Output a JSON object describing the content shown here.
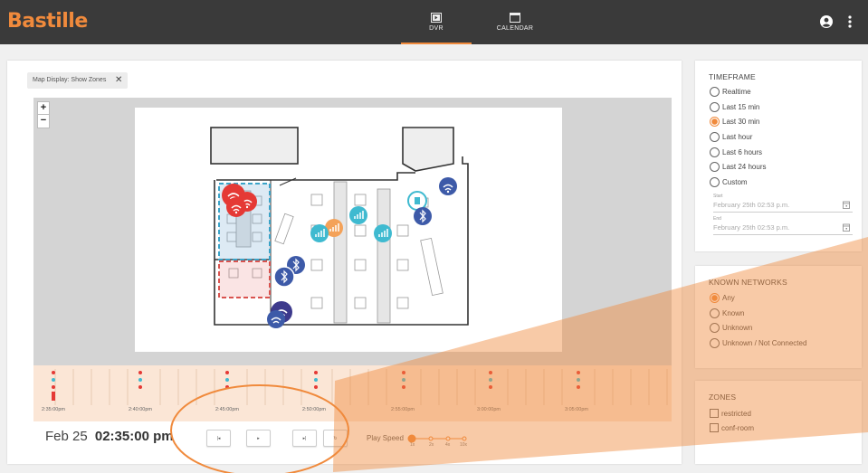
{
  "app": {
    "logo_text": "Bastille",
    "accent": "#f08a3c"
  },
  "nav": {
    "tabs": [
      {
        "label": "DVR",
        "icon": "play-square-icon",
        "active": true
      },
      {
        "label": "CALENDAR",
        "icon": "calendar-icon",
        "active": false
      }
    ],
    "account_icon": "account-circle-icon",
    "menu_icon": "more-vert-icon"
  },
  "filter_chip": {
    "label": "Map Display: Show Zones",
    "close": "✕"
  },
  "map": {
    "zoom_in": "+",
    "zoom_out": "−"
  },
  "timeline": {
    "labels": [
      "2:35:00pm",
      "2:40:00pm",
      "2:45:00pm",
      "2:50:00pm",
      "2:55:00pm",
      "3:00:00pm",
      "3:05:00pm"
    ]
  },
  "playback": {
    "date": "Feb 25",
    "time": "02:35:00 pm",
    "buttons": [
      {
        "name": "skip-back-button",
        "glyph": "|◂"
      },
      {
        "name": "play-button",
        "glyph": "▸"
      },
      {
        "name": "skip-forward-button",
        "glyph": "▸|"
      },
      {
        "name": "replay-button",
        "glyph": "↻"
      }
    ],
    "speed_label": "Play Speed",
    "speeds": [
      "1x",
      "2x",
      "4x",
      "10x"
    ],
    "speed_selected": "1x"
  },
  "timeframe": {
    "title": "TIMEFRAME",
    "options": [
      "Realtime",
      "Last 15 min",
      "Last 30 min",
      "Last hour",
      "Last 6 hours",
      "Last 24 hours",
      "Custom"
    ],
    "selected": "Last 30 min",
    "start_label": "Start",
    "start_value": "February 25th 02:53 p.m.",
    "end_label": "End",
    "end_value": "February 25th 02:53 p.m."
  },
  "known_networks": {
    "title": "KNOWN NETWORKS",
    "options": [
      "Any",
      "Known",
      "Unknown",
      "Unknown / Not Connected"
    ],
    "selected": "Any"
  },
  "zones": {
    "title": "ZONES",
    "options": [
      "restricted",
      "conf-room"
    ]
  }
}
